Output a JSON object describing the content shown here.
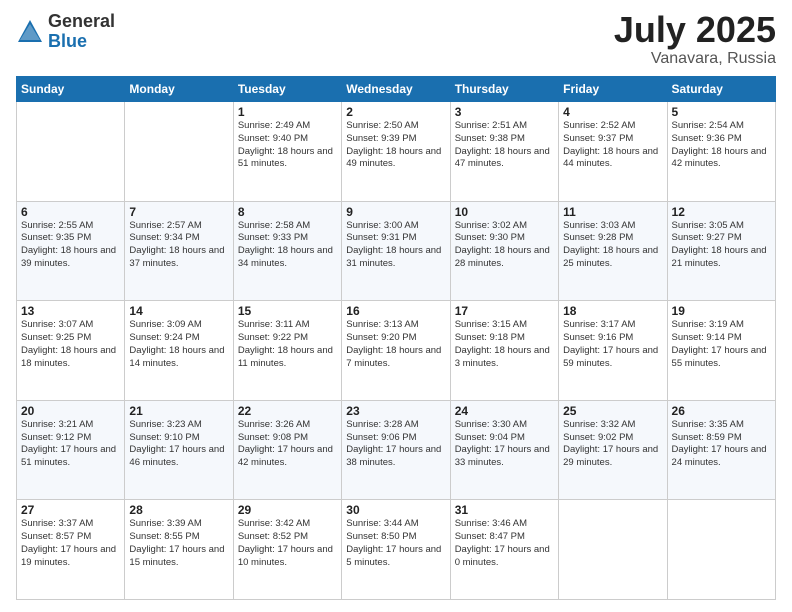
{
  "header": {
    "logo_general": "General",
    "logo_blue": "Blue",
    "title": "July 2025",
    "location": "Vanavara, Russia"
  },
  "days_of_week": [
    "Sunday",
    "Monday",
    "Tuesday",
    "Wednesday",
    "Thursday",
    "Friday",
    "Saturday"
  ],
  "weeks": [
    [
      {
        "day": "",
        "info": ""
      },
      {
        "day": "",
        "info": ""
      },
      {
        "day": "1",
        "info": "Sunrise: 2:49 AM\nSunset: 9:40 PM\nDaylight: 18 hours\nand 51 minutes."
      },
      {
        "day": "2",
        "info": "Sunrise: 2:50 AM\nSunset: 9:39 PM\nDaylight: 18 hours\nand 49 minutes."
      },
      {
        "day": "3",
        "info": "Sunrise: 2:51 AM\nSunset: 9:38 PM\nDaylight: 18 hours\nand 47 minutes."
      },
      {
        "day": "4",
        "info": "Sunrise: 2:52 AM\nSunset: 9:37 PM\nDaylight: 18 hours\nand 44 minutes."
      },
      {
        "day": "5",
        "info": "Sunrise: 2:54 AM\nSunset: 9:36 PM\nDaylight: 18 hours\nand 42 minutes."
      }
    ],
    [
      {
        "day": "6",
        "info": "Sunrise: 2:55 AM\nSunset: 9:35 PM\nDaylight: 18 hours\nand 39 minutes."
      },
      {
        "day": "7",
        "info": "Sunrise: 2:57 AM\nSunset: 9:34 PM\nDaylight: 18 hours\nand 37 minutes."
      },
      {
        "day": "8",
        "info": "Sunrise: 2:58 AM\nSunset: 9:33 PM\nDaylight: 18 hours\nand 34 minutes."
      },
      {
        "day": "9",
        "info": "Sunrise: 3:00 AM\nSunset: 9:31 PM\nDaylight: 18 hours\nand 31 minutes."
      },
      {
        "day": "10",
        "info": "Sunrise: 3:02 AM\nSunset: 9:30 PM\nDaylight: 18 hours\nand 28 minutes."
      },
      {
        "day": "11",
        "info": "Sunrise: 3:03 AM\nSunset: 9:28 PM\nDaylight: 18 hours\nand 25 minutes."
      },
      {
        "day": "12",
        "info": "Sunrise: 3:05 AM\nSunset: 9:27 PM\nDaylight: 18 hours\nand 21 minutes."
      }
    ],
    [
      {
        "day": "13",
        "info": "Sunrise: 3:07 AM\nSunset: 9:25 PM\nDaylight: 18 hours\nand 18 minutes."
      },
      {
        "day": "14",
        "info": "Sunrise: 3:09 AM\nSunset: 9:24 PM\nDaylight: 18 hours\nand 14 minutes."
      },
      {
        "day": "15",
        "info": "Sunrise: 3:11 AM\nSunset: 9:22 PM\nDaylight: 18 hours\nand 11 minutes."
      },
      {
        "day": "16",
        "info": "Sunrise: 3:13 AM\nSunset: 9:20 PM\nDaylight: 18 hours\nand 7 minutes."
      },
      {
        "day": "17",
        "info": "Sunrise: 3:15 AM\nSunset: 9:18 PM\nDaylight: 18 hours\nand 3 minutes."
      },
      {
        "day": "18",
        "info": "Sunrise: 3:17 AM\nSunset: 9:16 PM\nDaylight: 17 hours\nand 59 minutes."
      },
      {
        "day": "19",
        "info": "Sunrise: 3:19 AM\nSunset: 9:14 PM\nDaylight: 17 hours\nand 55 minutes."
      }
    ],
    [
      {
        "day": "20",
        "info": "Sunrise: 3:21 AM\nSunset: 9:12 PM\nDaylight: 17 hours\nand 51 minutes."
      },
      {
        "day": "21",
        "info": "Sunrise: 3:23 AM\nSunset: 9:10 PM\nDaylight: 17 hours\nand 46 minutes."
      },
      {
        "day": "22",
        "info": "Sunrise: 3:26 AM\nSunset: 9:08 PM\nDaylight: 17 hours\nand 42 minutes."
      },
      {
        "day": "23",
        "info": "Sunrise: 3:28 AM\nSunset: 9:06 PM\nDaylight: 17 hours\nand 38 minutes."
      },
      {
        "day": "24",
        "info": "Sunrise: 3:30 AM\nSunset: 9:04 PM\nDaylight: 17 hours\nand 33 minutes."
      },
      {
        "day": "25",
        "info": "Sunrise: 3:32 AM\nSunset: 9:02 PM\nDaylight: 17 hours\nand 29 minutes."
      },
      {
        "day": "26",
        "info": "Sunrise: 3:35 AM\nSunset: 8:59 PM\nDaylight: 17 hours\nand 24 minutes."
      }
    ],
    [
      {
        "day": "27",
        "info": "Sunrise: 3:37 AM\nSunset: 8:57 PM\nDaylight: 17 hours\nand 19 minutes."
      },
      {
        "day": "28",
        "info": "Sunrise: 3:39 AM\nSunset: 8:55 PM\nDaylight: 17 hours\nand 15 minutes."
      },
      {
        "day": "29",
        "info": "Sunrise: 3:42 AM\nSunset: 8:52 PM\nDaylight: 17 hours\nand 10 minutes."
      },
      {
        "day": "30",
        "info": "Sunrise: 3:44 AM\nSunset: 8:50 PM\nDaylight: 17 hours\nand 5 minutes."
      },
      {
        "day": "31",
        "info": "Sunrise: 3:46 AM\nSunset: 8:47 PM\nDaylight: 17 hours\nand 0 minutes."
      },
      {
        "day": "",
        "info": ""
      },
      {
        "day": "",
        "info": ""
      }
    ]
  ]
}
